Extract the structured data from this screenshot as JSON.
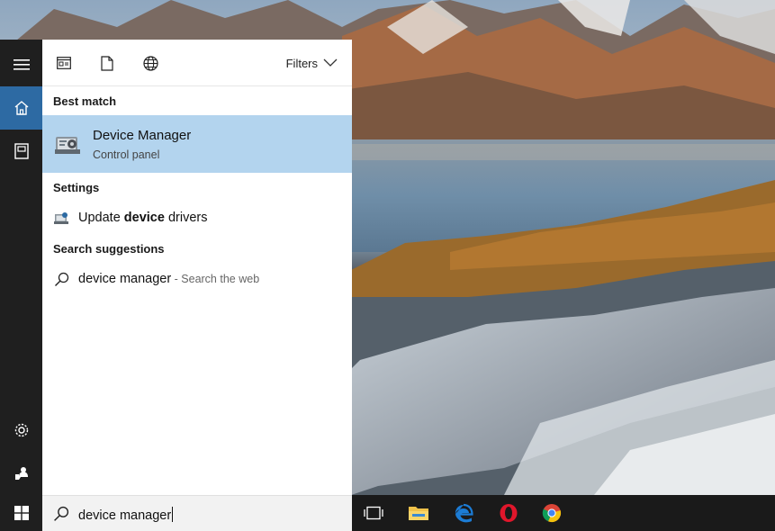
{
  "toolbar": {
    "icons": [
      "apps-icon",
      "documents-icon",
      "web-icon"
    ],
    "filters_label": "Filters"
  },
  "sections": {
    "best_match_header": "Best match",
    "settings_header": "Settings",
    "suggestions_header": "Search suggestions"
  },
  "best_match": {
    "title": "Device Manager",
    "subtitle": "Control panel",
    "icon": "device-manager-icon"
  },
  "settings_result": {
    "prefix": "Update ",
    "bold": "device",
    "suffix": " drivers",
    "icon": "settings-result-icon"
  },
  "suggestion": {
    "query": "device manager",
    "hint": " - Search the web",
    "icon": "search-icon"
  },
  "searchbox": {
    "value": "device manager"
  },
  "rail": {
    "items": [
      "hamburger-menu-icon",
      "home-icon",
      "notebook-icon",
      "settings-gear-icon",
      "feedback-icon"
    ]
  },
  "taskbar": {
    "apps": [
      "task-view-icon",
      "file-explorer-icon",
      "edge-browser-icon",
      "opera-browser-icon",
      "chrome-browser-icon"
    ]
  },
  "colors": {
    "accent": "#2d6aa3",
    "selection": "#b3d4ee",
    "rail": "#1f1f1f",
    "taskbar": "#1a1a1a"
  }
}
